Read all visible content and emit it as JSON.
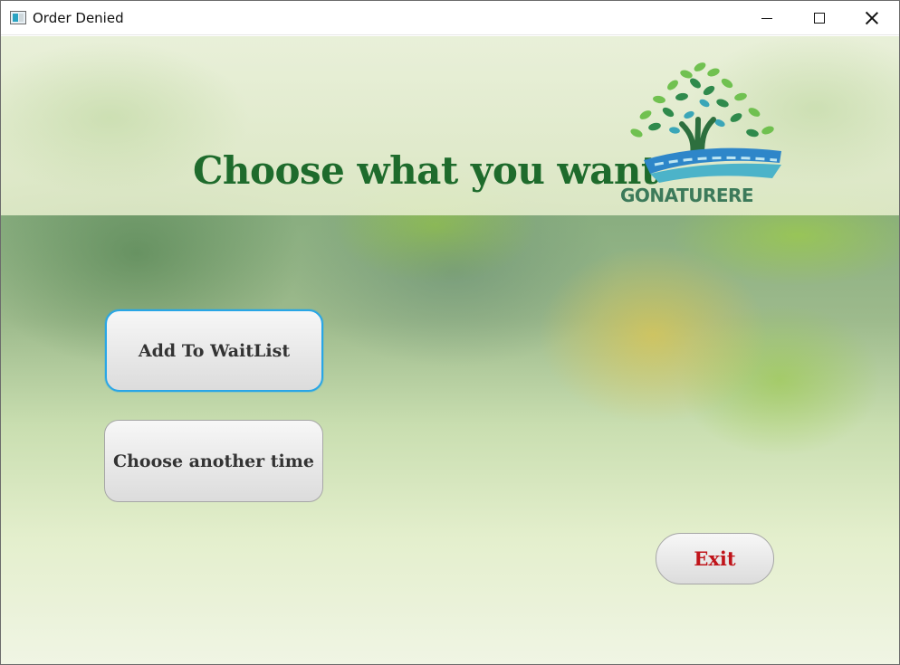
{
  "window": {
    "title": "Order Denied",
    "controls": {
      "minimize": "minimize",
      "maximize": "maximize",
      "close": "close"
    }
  },
  "header": {
    "headline": "Choose what you want",
    "logo_text": "GONATURERE",
    "headline_color": "#1e6b2c"
  },
  "actions": {
    "add_waitlist_label": "Add To WaitList",
    "choose_another_label": "Choose another time",
    "exit_label": "Exit",
    "exit_color": "#c0141a",
    "focus_color": "#29a6e6"
  }
}
